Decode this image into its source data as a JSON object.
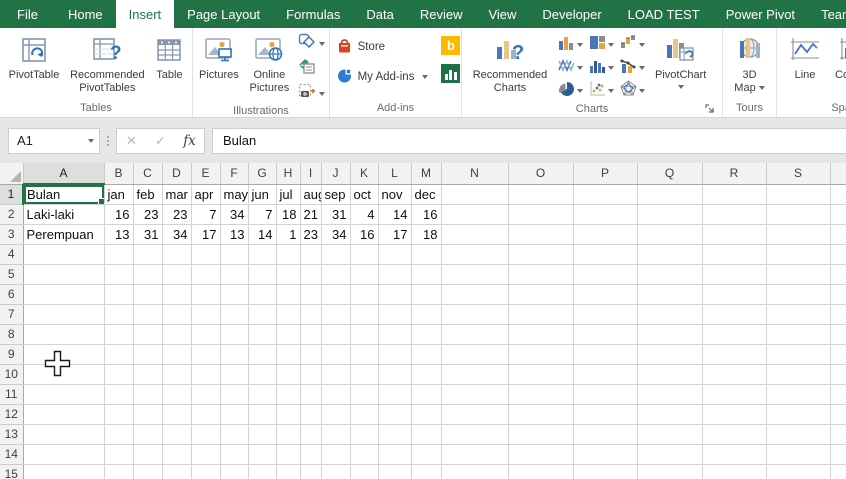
{
  "ribbon_tabs": [
    {
      "label": "File",
      "active": false
    },
    {
      "label": "Home",
      "active": false
    },
    {
      "label": "Insert",
      "active": true
    },
    {
      "label": "Page Layout",
      "active": false
    },
    {
      "label": "Formulas",
      "active": false
    },
    {
      "label": "Data",
      "active": false
    },
    {
      "label": "Review",
      "active": false
    },
    {
      "label": "View",
      "active": false
    },
    {
      "label": "Developer",
      "active": false
    },
    {
      "label": "LOAD TEST",
      "active": false
    },
    {
      "label": "Power Pivot",
      "active": false
    },
    {
      "label": "Team",
      "active": false
    }
  ],
  "ribbon": {
    "tables": {
      "label": "Tables",
      "pivottable": "PivotTable",
      "recommended_pivottables": "Recommended PivotTables",
      "table": "Table"
    },
    "illustrations": {
      "label": "Illustrations",
      "pictures": "Pictures",
      "online_pictures": "Online Pictures"
    },
    "addins": {
      "label": "Add-ins",
      "store": "Store",
      "my_addins": "My Add-ins",
      "bing_b": "b"
    },
    "charts": {
      "label": "Charts",
      "recommended_charts": "Recommended Charts",
      "pivotchart": "PivotChart"
    },
    "tours": {
      "label": "Tours",
      "map3d_line1": "3D",
      "map3d_line2": "Map"
    },
    "sparklines": {
      "label": "Sparklines",
      "line": "Line",
      "column": "Column"
    }
  },
  "formula_bar": {
    "name_box": "A1",
    "formula": "Bulan",
    "fx_label": "fx",
    "cancel_glyph": "✕",
    "enter_glyph": "✓"
  },
  "sheet": {
    "column_headers": [
      "A",
      "B",
      "C",
      "D",
      "E",
      "F",
      "G",
      "H",
      "I",
      "J",
      "K",
      "L",
      "M",
      "N",
      "O",
      "P",
      "Q",
      "R",
      "S"
    ],
    "visible_rows": 15,
    "selected_cell": "A1",
    "rows": [
      {
        "row": 1,
        "values": [
          "Bulan",
          "jan",
          "feb",
          "mar",
          "apr",
          "may",
          "jun",
          "jul",
          "aug",
          "sep",
          "oct",
          "nov",
          "dec"
        ]
      },
      {
        "row": 2,
        "values": [
          "Laki-laki",
          16,
          23,
          23,
          7,
          34,
          7,
          18,
          21,
          31,
          4,
          14,
          16
        ]
      },
      {
        "row": 3,
        "values": [
          "Perempuan",
          13,
          31,
          34,
          17,
          13,
          14,
          1,
          23,
          34,
          16,
          17,
          18
        ]
      }
    ]
  },
  "colors": {
    "excel_green": "#217346",
    "store_orange": "#d6431f",
    "bing_yellow": "#ffb900",
    "addin_blue": "#2b7cd3",
    "smartart_green": "#35967c",
    "chart_blue": "#4a76b9",
    "chart_tan": "#e8a33d",
    "chart_gray": "#8c8c8c"
  }
}
